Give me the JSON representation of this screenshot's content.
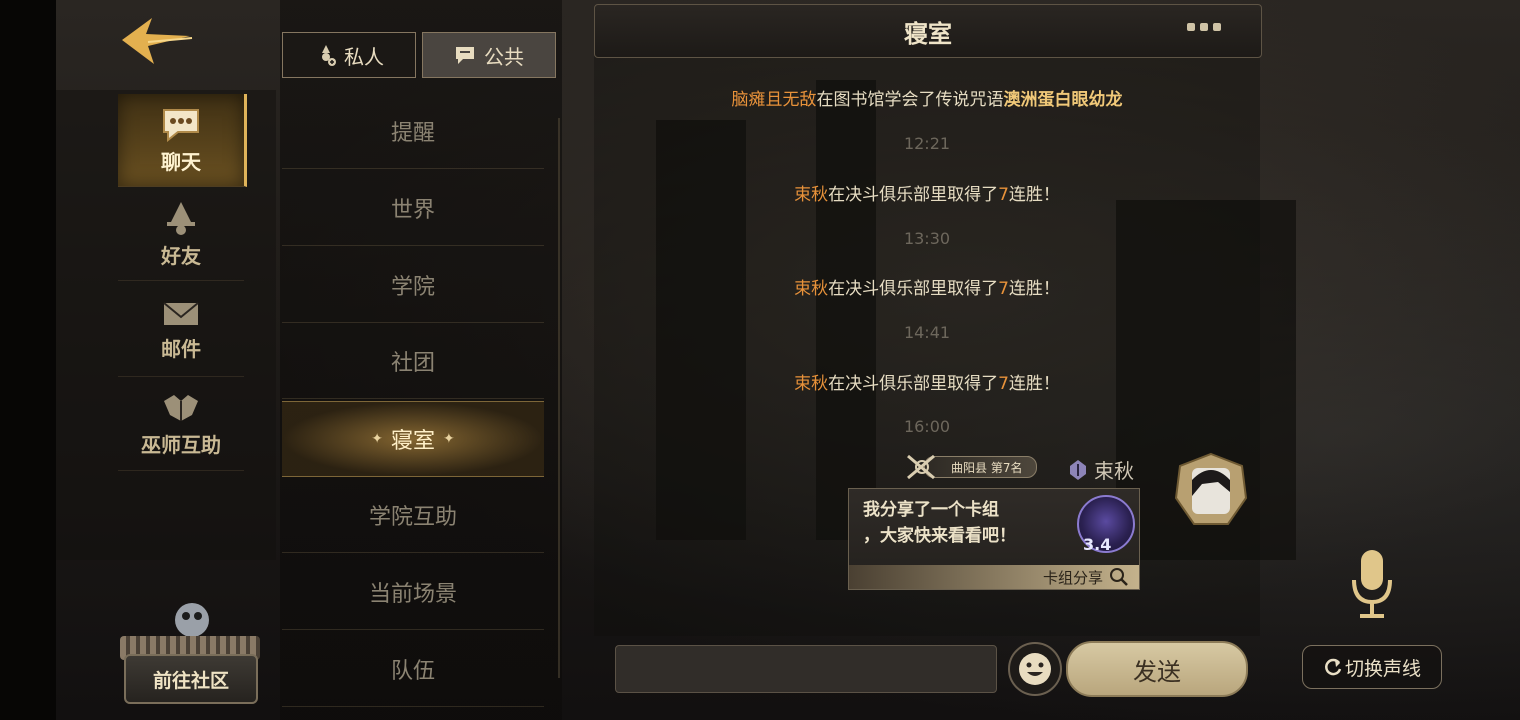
{
  "sidebar": {
    "items": [
      {
        "label": "聊天"
      },
      {
        "label": "好友"
      },
      {
        "label": "邮件"
      },
      {
        "label": "巫师互助"
      }
    ],
    "community_label": "前往社区"
  },
  "tabs": {
    "private_label": "私人",
    "public_label": "公共"
  },
  "channels": [
    {
      "label": "提醒"
    },
    {
      "label": "世界"
    },
    {
      "label": "学院"
    },
    {
      "label": "社团"
    },
    {
      "label": "寝室"
    },
    {
      "label": "学院互助"
    },
    {
      "label": "当前场景"
    },
    {
      "label": "队伍"
    }
  ],
  "chat": {
    "title": "寝室",
    "messages": [
      {
        "name": "脑瘫且无敌",
        "text": "在图书馆学会了传说咒语",
        "highlight": "澳洲蛋白眼幼龙"
      },
      {
        "time": "12:21",
        "name": "束秋",
        "text_a": "在决斗俱乐部里取得了",
        "num": "7",
        "text_b": "连胜！"
      },
      {
        "time": "13:30",
        "name": "束秋",
        "text_a": "在决斗俱乐部里取得了",
        "num": "7",
        "text_b": "连胜！"
      },
      {
        "time": "14:41",
        "name": "束秋",
        "text_a": "在决斗俱乐部里取得了",
        "num": "7",
        "text_b": "连胜！"
      }
    ],
    "last_time": "16:00",
    "user_message": {
      "rank": "曲阳县 第7名",
      "sender": "束秋",
      "text": "我分享了一个卡组\n，大家快来看看吧！",
      "score": "3.4",
      "footer_label": "卡组分享"
    }
  },
  "input": {
    "value": "",
    "placeholder": "",
    "send_label": "发送",
    "switch_voice_label": "切换声线"
  }
}
